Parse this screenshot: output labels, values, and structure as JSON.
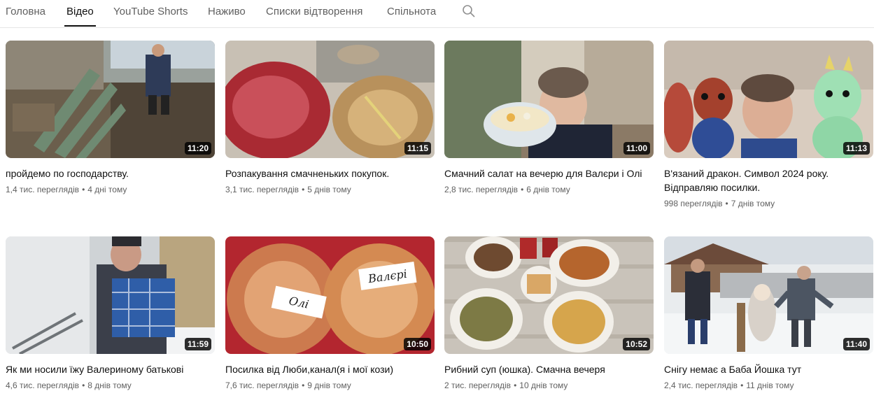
{
  "tabs": [
    {
      "label": "Головна",
      "active": false
    },
    {
      "label": "Відео",
      "active": true
    },
    {
      "label": "YouTube Shorts",
      "active": false
    },
    {
      "label": "Наживо",
      "active": false
    },
    {
      "label": "Списки відтворення",
      "active": false
    },
    {
      "label": "Спільнота",
      "active": false
    }
  ],
  "search": {
    "icon": "search-icon"
  },
  "videos": [
    {
      "title": "пройдемо по господарству.",
      "views": "1,4 тис. переглядів",
      "age": "4 дні тому",
      "duration": "11:20"
    },
    {
      "title": "Розпакування смачненьких покупок.",
      "views": "3,1 тис. переглядів",
      "age": "5 днів тому",
      "duration": "11:15"
    },
    {
      "title": "Смачний салат на вечерю для Валєри і Олі",
      "views": "2,8 тис. переглядів",
      "age": "6 днів тому",
      "duration": "11:00"
    },
    {
      "title": "В'язаний дракон. Символ 2024 року. Відправляю посилки.",
      "views": "998 переглядів",
      "age": "7 днів тому",
      "duration": "11:13"
    },
    {
      "title": "Як ми носили їжу Валериному батькові",
      "views": "4,6 тис. переглядів",
      "age": "8 днів тому",
      "duration": "11:59"
    },
    {
      "title": "Посилка від Люби,канал(я і мої кози)",
      "views": "7,6 тис. переглядів",
      "age": "9 днів тому",
      "duration": "10:50"
    },
    {
      "title": "Рибний суп (юшка). Смачна вечеря",
      "views": "2 тис. переглядів",
      "age": "10 днів тому",
      "duration": "10:52"
    },
    {
      "title": "Снігу немає а Баба Йошка тут",
      "views": "2,4 тис. переглядів",
      "age": "11 днів тому",
      "duration": "11:40"
    }
  ],
  "thumb_labels": {
    "v6_a": "Олі",
    "v6_b": "Валєрі"
  }
}
